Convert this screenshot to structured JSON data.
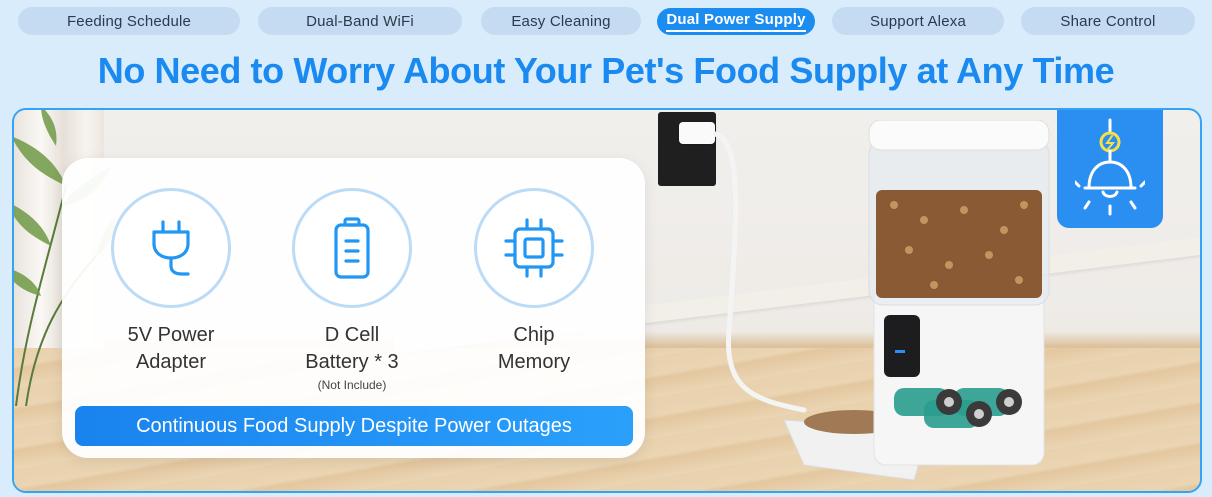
{
  "tabs": [
    {
      "label": "Feeding Schedule"
    },
    {
      "label": "Dual-Band WiFi"
    },
    {
      "label": "Easy Cleaning"
    },
    {
      "label": "Dual Power Supply"
    },
    {
      "label": "Support Alexa"
    },
    {
      "label": "Share Control"
    }
  ],
  "active_tab": "Dual Power Supply",
  "headline": "No Need to Worry About Your Pet's Food Supply at Any Time",
  "features": [
    {
      "icon": "power-plug-icon",
      "label": "5V Power\nAdapter",
      "note": ""
    },
    {
      "icon": "battery-icon",
      "label": "D Cell\nBattery * 3",
      "note": "(Not Include)"
    },
    {
      "icon": "chip-icon",
      "label": "Chip\nMemory",
      "note": ""
    }
  ],
  "cta_text": "Continuous Food Supply Despite Power Outages",
  "colors": {
    "accent": "#1a8af0",
    "tab_bg": "#c4dbf1",
    "page_bg": "#d9ecfb",
    "icon_blue": "#2196f3"
  },
  "badge_icon": "lamp-power-icon"
}
